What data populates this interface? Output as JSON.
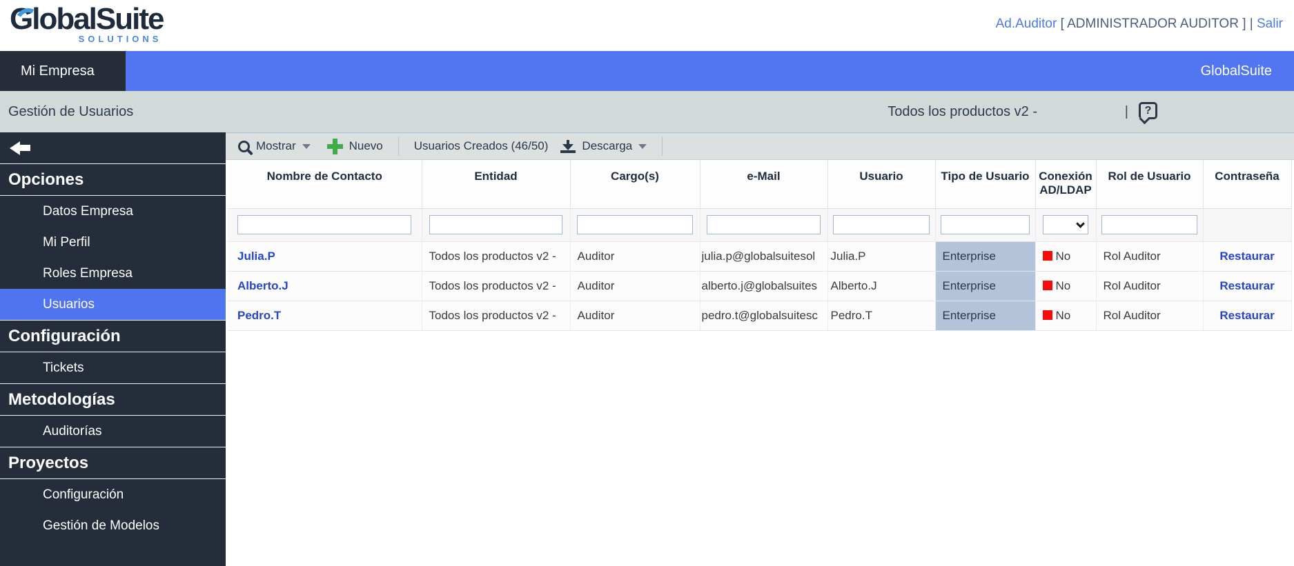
{
  "colors": {
    "accent_blue": "#5276f2",
    "sidebar_bg": "#252c3a",
    "link_blue": "#2744cc",
    "green_plus": "#3fae4a",
    "status_red": "#fa0a0a",
    "enterprise_bg": "#b3c3da",
    "crumb_bg": "#d3d9d9"
  },
  "header": {
    "logo_text": "GlobalSuite",
    "logo_sub": "SOLUTIONS",
    "user": "Ad.Auditor",
    "role": "[ ADMINISTRADOR AUDITOR ]",
    "divider": "|",
    "logout": "Salir"
  },
  "tabbar": {
    "active_tab": "Mi Empresa",
    "brand": "GlobalSuite"
  },
  "crumb": {
    "title": "Gestión de Usuarios",
    "product": "Todos los productos v2 -",
    "separator": "|",
    "help_glyph": "?"
  },
  "sidebar": {
    "items": [
      {
        "label": "Opciones",
        "type": "header"
      },
      {
        "label": "Datos Empresa",
        "type": "item"
      },
      {
        "label": "Mi Perfil",
        "type": "item"
      },
      {
        "label": "Roles Empresa",
        "type": "item"
      },
      {
        "label": "Usuarios",
        "type": "item",
        "active": true
      },
      {
        "label": "Configuración",
        "type": "header"
      },
      {
        "label": "Tickets",
        "type": "item"
      },
      {
        "label": "Metodologías",
        "type": "header"
      },
      {
        "label": "Auditorías",
        "type": "item"
      },
      {
        "label": "Proyectos",
        "type": "header"
      },
      {
        "label": "Configuración",
        "type": "item"
      },
      {
        "label": "Gestión de Modelos",
        "type": "item"
      }
    ]
  },
  "toolbar": {
    "mostrar_label": "Mostrar",
    "nuevo_label": "Nuevo",
    "created_label": "Usuarios Creados (46/50)",
    "descarga_label": "Descarga"
  },
  "icons": {
    "search": "magnifier",
    "plus": "green-plus",
    "download": "arrow-down-to-bar",
    "caret": "triangle-down",
    "select_chevron": "chevron-down",
    "back": "arrow-left",
    "help": "question-bubble",
    "conexion_status": "red-square"
  },
  "table": {
    "columns": [
      "Nombre de Contacto",
      "Entidad",
      "Cargo(s)",
      "e-Mail",
      "Usuario",
      "Tipo de Usuario",
      "Conexión AD/LDAP",
      "Rol de Usuario",
      "Contraseña"
    ],
    "rows": [
      {
        "nombre": "Julia.P",
        "entidad": "Todos los productos v2 -",
        "cargo": "Auditor",
        "email": "julia.p@globalsuitesol",
        "usuario": "Julia.P",
        "tipo": "Enterprise",
        "conexion": "No",
        "rol": "Rol Auditor",
        "contrasena": "Restaurar"
      },
      {
        "nombre": "Alberto.J",
        "entidad": "Todos los productos v2 -",
        "cargo": "Auditor",
        "email": "alberto.j@globalsuites",
        "usuario": "Alberto.J",
        "tipo": "Enterprise",
        "conexion": "No",
        "rol": "Rol Auditor",
        "contrasena": "Restaurar"
      },
      {
        "nombre": "Pedro.T",
        "entidad": "Todos los productos v2 -",
        "cargo": "Auditor",
        "email": "pedro.t@globalsuitesc",
        "usuario": "Pedro.T",
        "tipo": "Enterprise",
        "conexion": "No",
        "rol": "Rol Auditor",
        "contrasena": "Restaurar"
      }
    ]
  }
}
